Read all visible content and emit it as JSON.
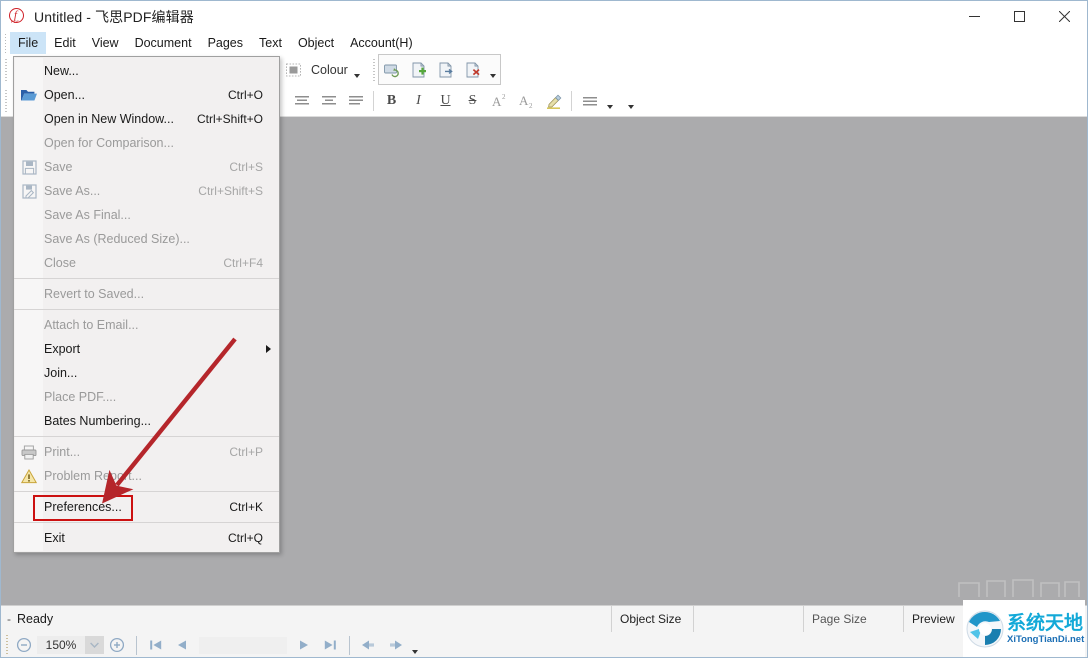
{
  "window": {
    "title": "Untitled - 飞思PDF编辑器",
    "app_icon": "pdf-app-icon",
    "minimize_label": "Minimize",
    "maximize_label": "Maximize",
    "close_label": "Close"
  },
  "menubar": {
    "items": [
      {
        "label": "File",
        "active": true
      },
      {
        "label": "Edit",
        "active": false
      },
      {
        "label": "View",
        "active": false
      },
      {
        "label": "Document",
        "active": false
      },
      {
        "label": "Pages",
        "active": false
      },
      {
        "label": "Text",
        "active": false
      },
      {
        "label": "Object",
        "active": false
      },
      {
        "label": "Account(H)",
        "active": false
      }
    ]
  },
  "toolbar": {
    "row1": [
      {
        "icon": "undo-icon",
        "name": "undo-button"
      },
      {
        "sep": true
      },
      {
        "icon": "text-tool-icon",
        "name": "add-text-button"
      },
      {
        "icon": "text-edit-icon",
        "name": "edit-text-button"
      },
      {
        "icon": "text-number-icon",
        "name": "text-numbering-button"
      },
      {
        "sep": true
      },
      {
        "icon": "crop-icon",
        "name": "crop-button"
      },
      {
        "icon": "attachment-icon",
        "name": "attachment-button"
      },
      {
        "icon": "camera-icon",
        "name": "snapshot-button"
      },
      {
        "icon": "link-icon",
        "name": "link-button"
      },
      {
        "sep": true
      },
      {
        "icon": "eyedropper-icon",
        "name": "eyedropper-button"
      },
      {
        "icon": "colour-swatch-icon",
        "name": "colour-swatch-button"
      }
    ],
    "colour_label": "Colour",
    "row1_right": [
      {
        "icon": "page-refresh-icon",
        "name": "refresh-page-button"
      },
      {
        "icon": "page-add-icon",
        "name": "add-page-button"
      },
      {
        "icon": "page-export-icon",
        "name": "export-page-button"
      },
      {
        "icon": "page-delete-icon",
        "name": "delete-page-button"
      }
    ],
    "row2": [
      {
        "icon": "align-left-icon",
        "name": "align-left-button"
      },
      {
        "icon": "align-center-icon",
        "name": "align-center-button"
      },
      {
        "icon": "align-justify-icon",
        "name": "align-justify-button"
      },
      {
        "sep": true
      },
      {
        "icon": "bold-icon",
        "name": "bold-button",
        "text": "B"
      },
      {
        "icon": "italic-icon",
        "name": "italic-button",
        "text": "I"
      },
      {
        "icon": "underline-icon",
        "name": "underline-button",
        "text": "U"
      },
      {
        "icon": "strikethrough-icon",
        "name": "strikethrough-button",
        "text": "S"
      },
      {
        "icon": "superscript-icon",
        "name": "superscript-button",
        "text": "A"
      },
      {
        "icon": "subscript-icon",
        "name": "subscript-button",
        "text": "A"
      },
      {
        "icon": "highlighter-icon",
        "name": "highlighter-button"
      },
      {
        "sep": true
      },
      {
        "icon": "list-icon",
        "name": "list-button"
      }
    ]
  },
  "file_menu": {
    "groups": [
      [
        {
          "label": "New...",
          "accel": "",
          "disabled": false,
          "icon": ""
        },
        {
          "label": "Open...",
          "accel": "Ctrl+O",
          "disabled": false,
          "icon": "folder-open-icon"
        },
        {
          "label": "Open in New Window...",
          "accel": "Ctrl+Shift+O",
          "disabled": false,
          "icon": ""
        },
        {
          "label": "Open for Comparison...",
          "accel": "",
          "disabled": true,
          "icon": ""
        },
        {
          "label": "Save",
          "accel": "Ctrl+S",
          "disabled": true,
          "icon": "save-icon"
        },
        {
          "label": "Save As...",
          "accel": "Ctrl+Shift+S",
          "disabled": true,
          "icon": "save-as-icon"
        },
        {
          "label": "Save As Final...",
          "accel": "",
          "disabled": true,
          "icon": ""
        },
        {
          "label": "Save As (Reduced Size)...",
          "accel": "",
          "disabled": true,
          "icon": ""
        },
        {
          "label": "Close",
          "accel": "Ctrl+F4",
          "disabled": true,
          "icon": ""
        }
      ],
      [
        {
          "label": "Revert to Saved...",
          "accel": "",
          "disabled": true,
          "icon": ""
        }
      ],
      [
        {
          "label": "Attach to Email...",
          "accel": "",
          "disabled": true,
          "icon": ""
        },
        {
          "label": "Export",
          "accel": "",
          "disabled": false,
          "icon": "",
          "submenu": true
        },
        {
          "label": "Join...",
          "accel": "",
          "disabled": false,
          "icon": ""
        },
        {
          "label": "Place PDF....",
          "accel": "",
          "disabled": true,
          "icon": ""
        },
        {
          "label": "Bates Numbering...",
          "accel": "",
          "disabled": false,
          "icon": ""
        }
      ],
      [
        {
          "label": "Print...",
          "accel": "Ctrl+P",
          "disabled": true,
          "icon": "printer-icon"
        },
        {
          "label": "Problem Report...",
          "accel": "",
          "disabled": true,
          "icon": "warning-icon"
        }
      ],
      [
        {
          "label": "Preferences...",
          "accel": "Ctrl+K",
          "disabled": false,
          "icon": "",
          "highlighted": true
        }
      ],
      [
        {
          "label": "Exit",
          "accel": "Ctrl+Q",
          "disabled": false,
          "icon": ""
        }
      ]
    ]
  },
  "annotation": {
    "highlight_color": "#cc1111",
    "arrow_color": "#b5262b",
    "target_label": "Preferences..."
  },
  "statusbar": {
    "dash": "-",
    "ready_text": "Ready",
    "object_size_label": "Object Size",
    "page_size_label": "Page Size",
    "preview_label": "Preview",
    "zoom_value": "150%",
    "page_value": "",
    "zoom_out_icon": "zoom-out-icon",
    "zoom_in_icon": "zoom-in-icon",
    "nav": [
      {
        "icon": "first-page-icon",
        "name": "first-page-button"
      },
      {
        "icon": "prev-page-icon",
        "name": "previous-page-button"
      },
      {
        "icon": "next-page-icon",
        "name": "next-page-button"
      },
      {
        "icon": "last-page-icon",
        "name": "last-page-button"
      },
      {
        "icon": "back-view-icon",
        "name": "previous-view-button"
      },
      {
        "icon": "forward-view-icon",
        "name": "next-view-button"
      }
    ]
  },
  "watermark": {
    "cn_text": "系统天地",
    "en_text": "XiTongTianDi.net",
    "accent_color": "#13a9d8"
  }
}
